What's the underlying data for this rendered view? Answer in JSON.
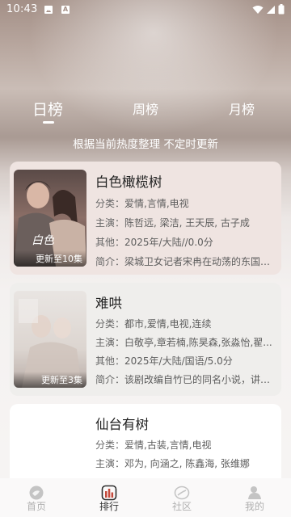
{
  "status_bar": {
    "time": "10:43",
    "icons": [
      "image-notification-icon",
      "a-notification-icon",
      "wifi-icon",
      "signal-icon",
      "battery-icon"
    ]
  },
  "tabs": [
    {
      "label": "日榜",
      "active": true
    },
    {
      "label": "周榜",
      "active": false
    },
    {
      "label": "月榜",
      "active": false
    }
  ],
  "subtitle": "根据当前热度整理 不定时更新",
  "cards": [
    {
      "title": "白色橄榄树",
      "badge": "更新至10集",
      "genre_label": "分类：",
      "genre": "爱情,言情,电视",
      "cast_label": "主演：",
      "cast": "陈哲远, 梁洁, 王天辰, 古子成",
      "other_label": "其他：",
      "other": "2025年/大陆//0.0分",
      "summary_label": "简介：",
      "summary": "梁城卫女记者宋冉在动荡的东国执..."
    },
    {
      "title": "难哄",
      "badge": "更新至3集",
      "genre_label": "分类：",
      "genre": "都市,爱情,电视,连续",
      "cast_label": "主演：",
      "cast": "白敬亭,章若楠,陈昊森,张淼怡,翟...",
      "other_label": "其他：",
      "other": "2025年/大陆/国语/5.0分",
      "summary_label": "简介：",
      "summary": "该剧改编自竹已的同名小说，讲述..."
    },
    {
      "title": "仙台有树",
      "genre_label": "分类：",
      "genre": "爱情,古装,言情,电视",
      "cast_label": "主演：",
      "cast": "邓为, 向涵之, 陈鑫海, 张维娜"
    }
  ],
  "nav": [
    {
      "label": "首页",
      "icon": "home-icon",
      "active": false
    },
    {
      "label": "排行",
      "icon": "ranking-icon",
      "active": true
    },
    {
      "label": "社区",
      "icon": "community-icon",
      "active": false
    },
    {
      "label": "我的",
      "icon": "profile-icon",
      "active": false
    }
  ],
  "colors": {
    "accent": "#333333",
    "inactive_nav": "#b0b0b0",
    "card1_bg": "#efe4e1",
    "ranking_icon": "#c44a3c"
  }
}
